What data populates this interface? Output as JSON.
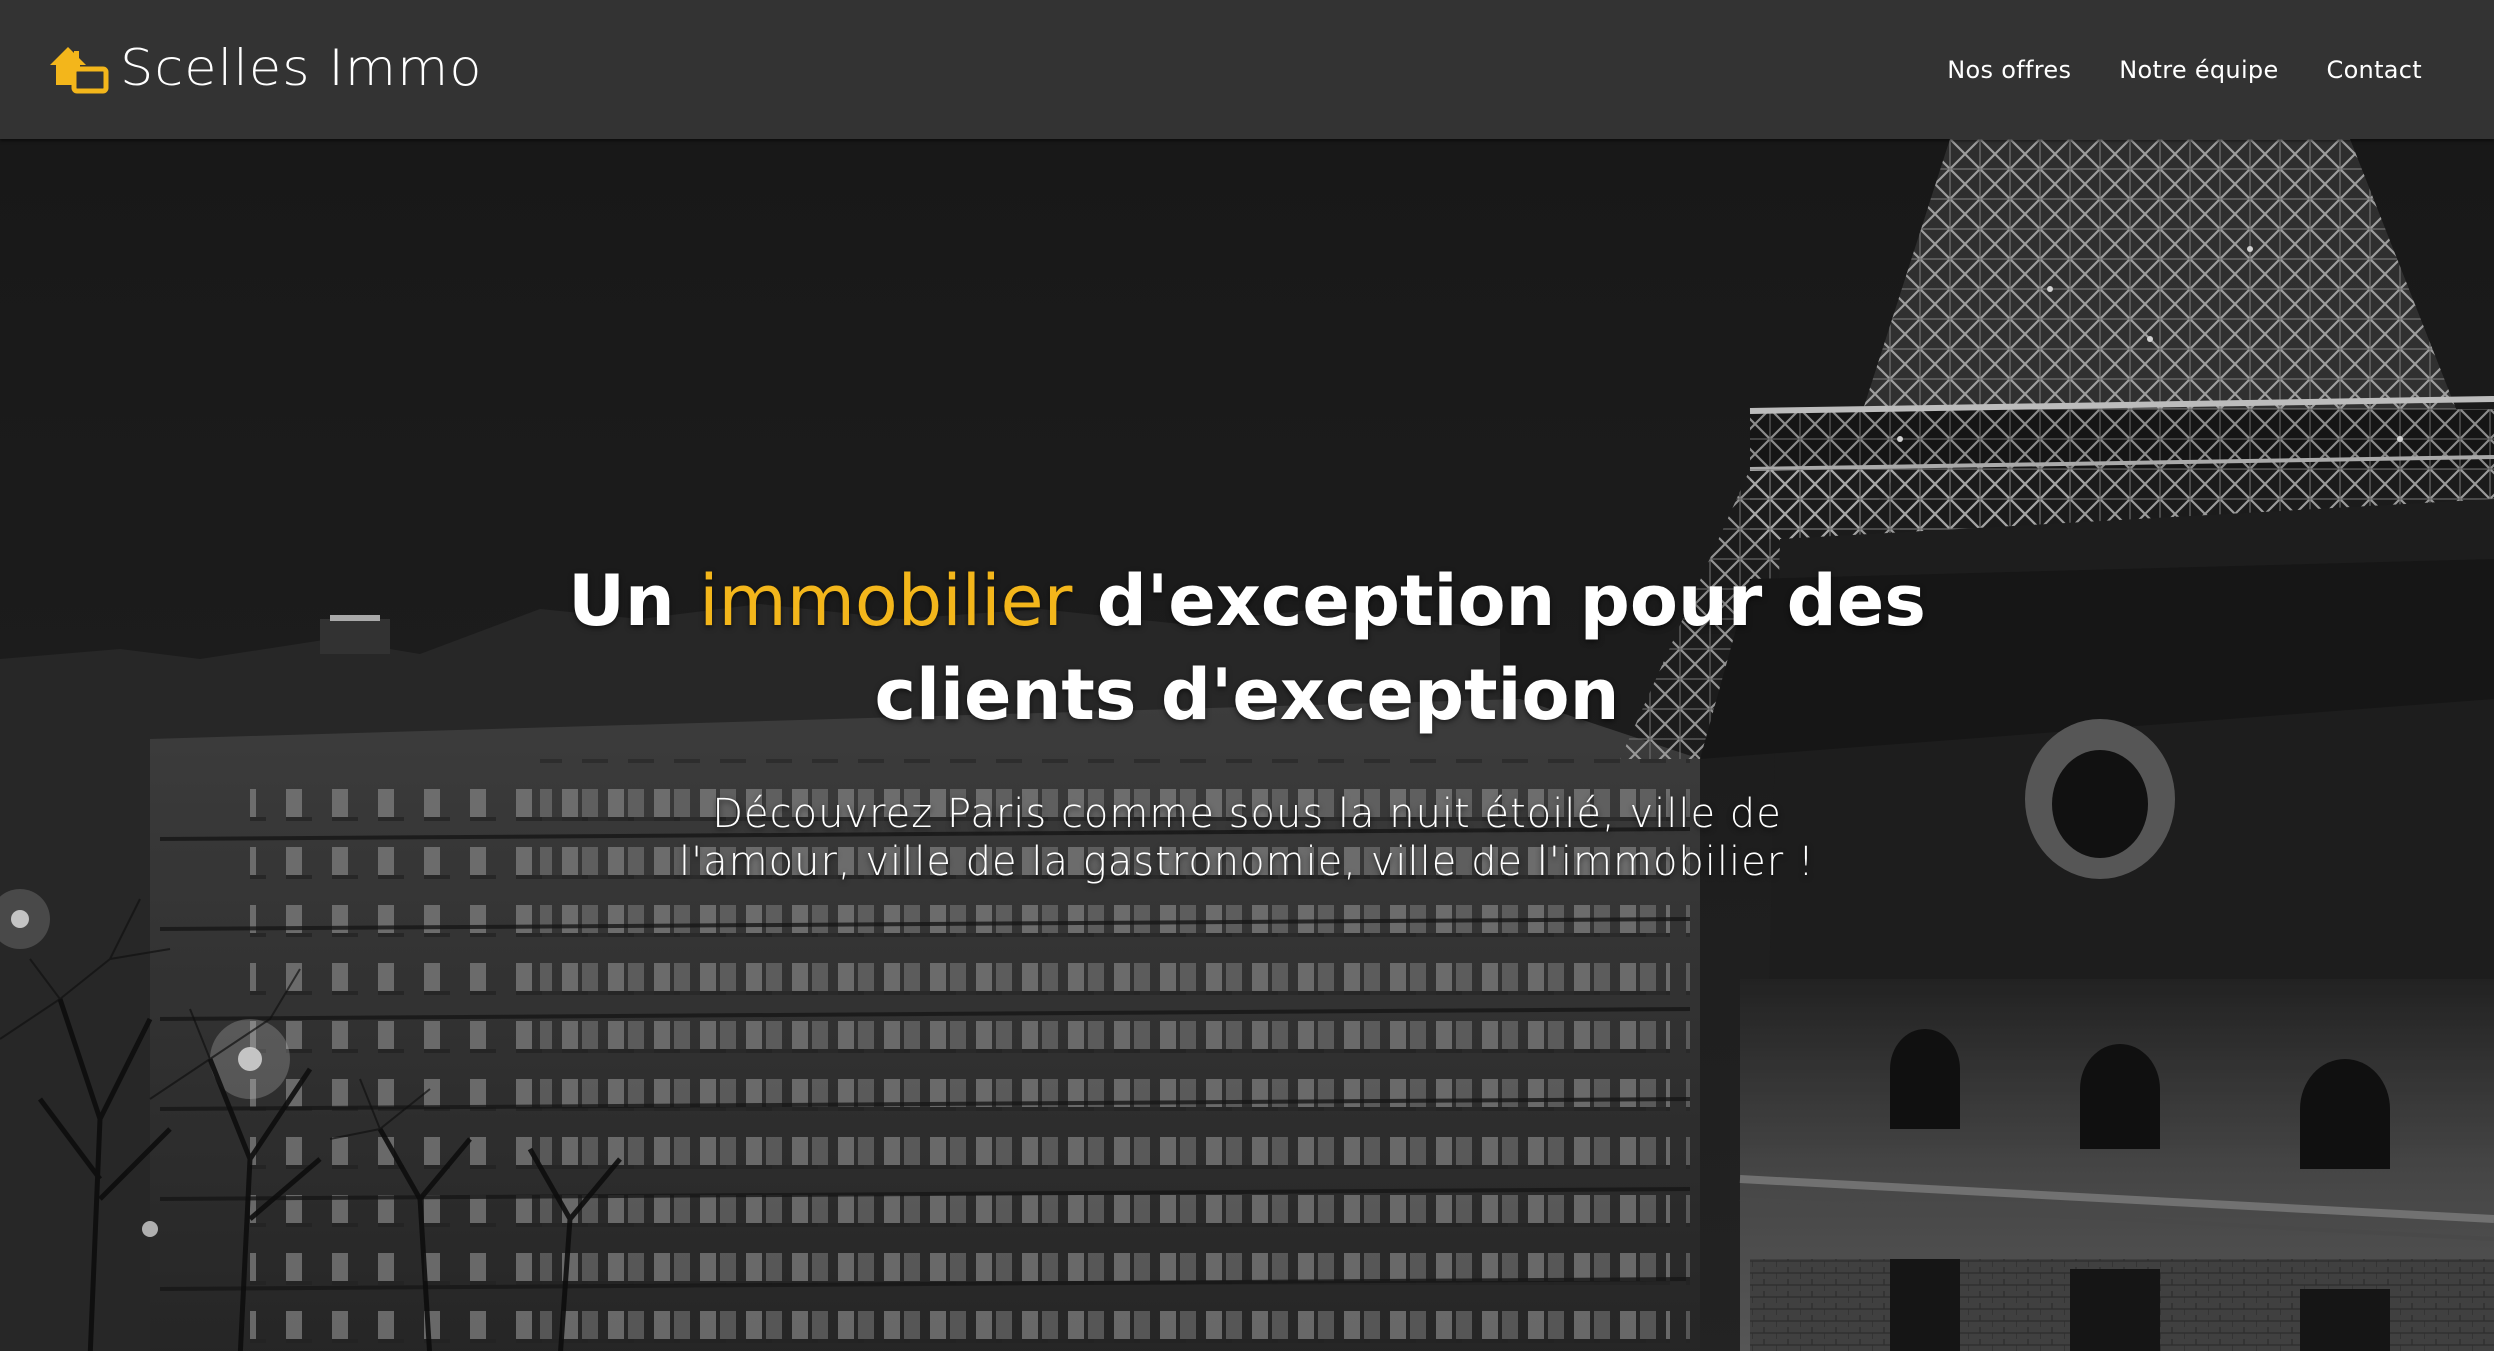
{
  "header": {
    "brand_name": "Scelles Immo",
    "brand_icon": "house-icon",
    "accent_color": "#f3b61b",
    "nav": [
      {
        "label": "Nos offres"
      },
      {
        "label": "Notre équipe"
      },
      {
        "label": "Contact"
      }
    ]
  },
  "hero": {
    "title_part1": "Un ",
    "title_accent": "immobilier",
    "title_part2": " d'exception pour des clients d'exception",
    "subtitle": "Découvrez Paris comme sous la nuit étoilé, ville de l'amour, ville de la gastronomie, ville de l'immobilier !",
    "background": "paris-night-eiffel-tower-photo"
  }
}
